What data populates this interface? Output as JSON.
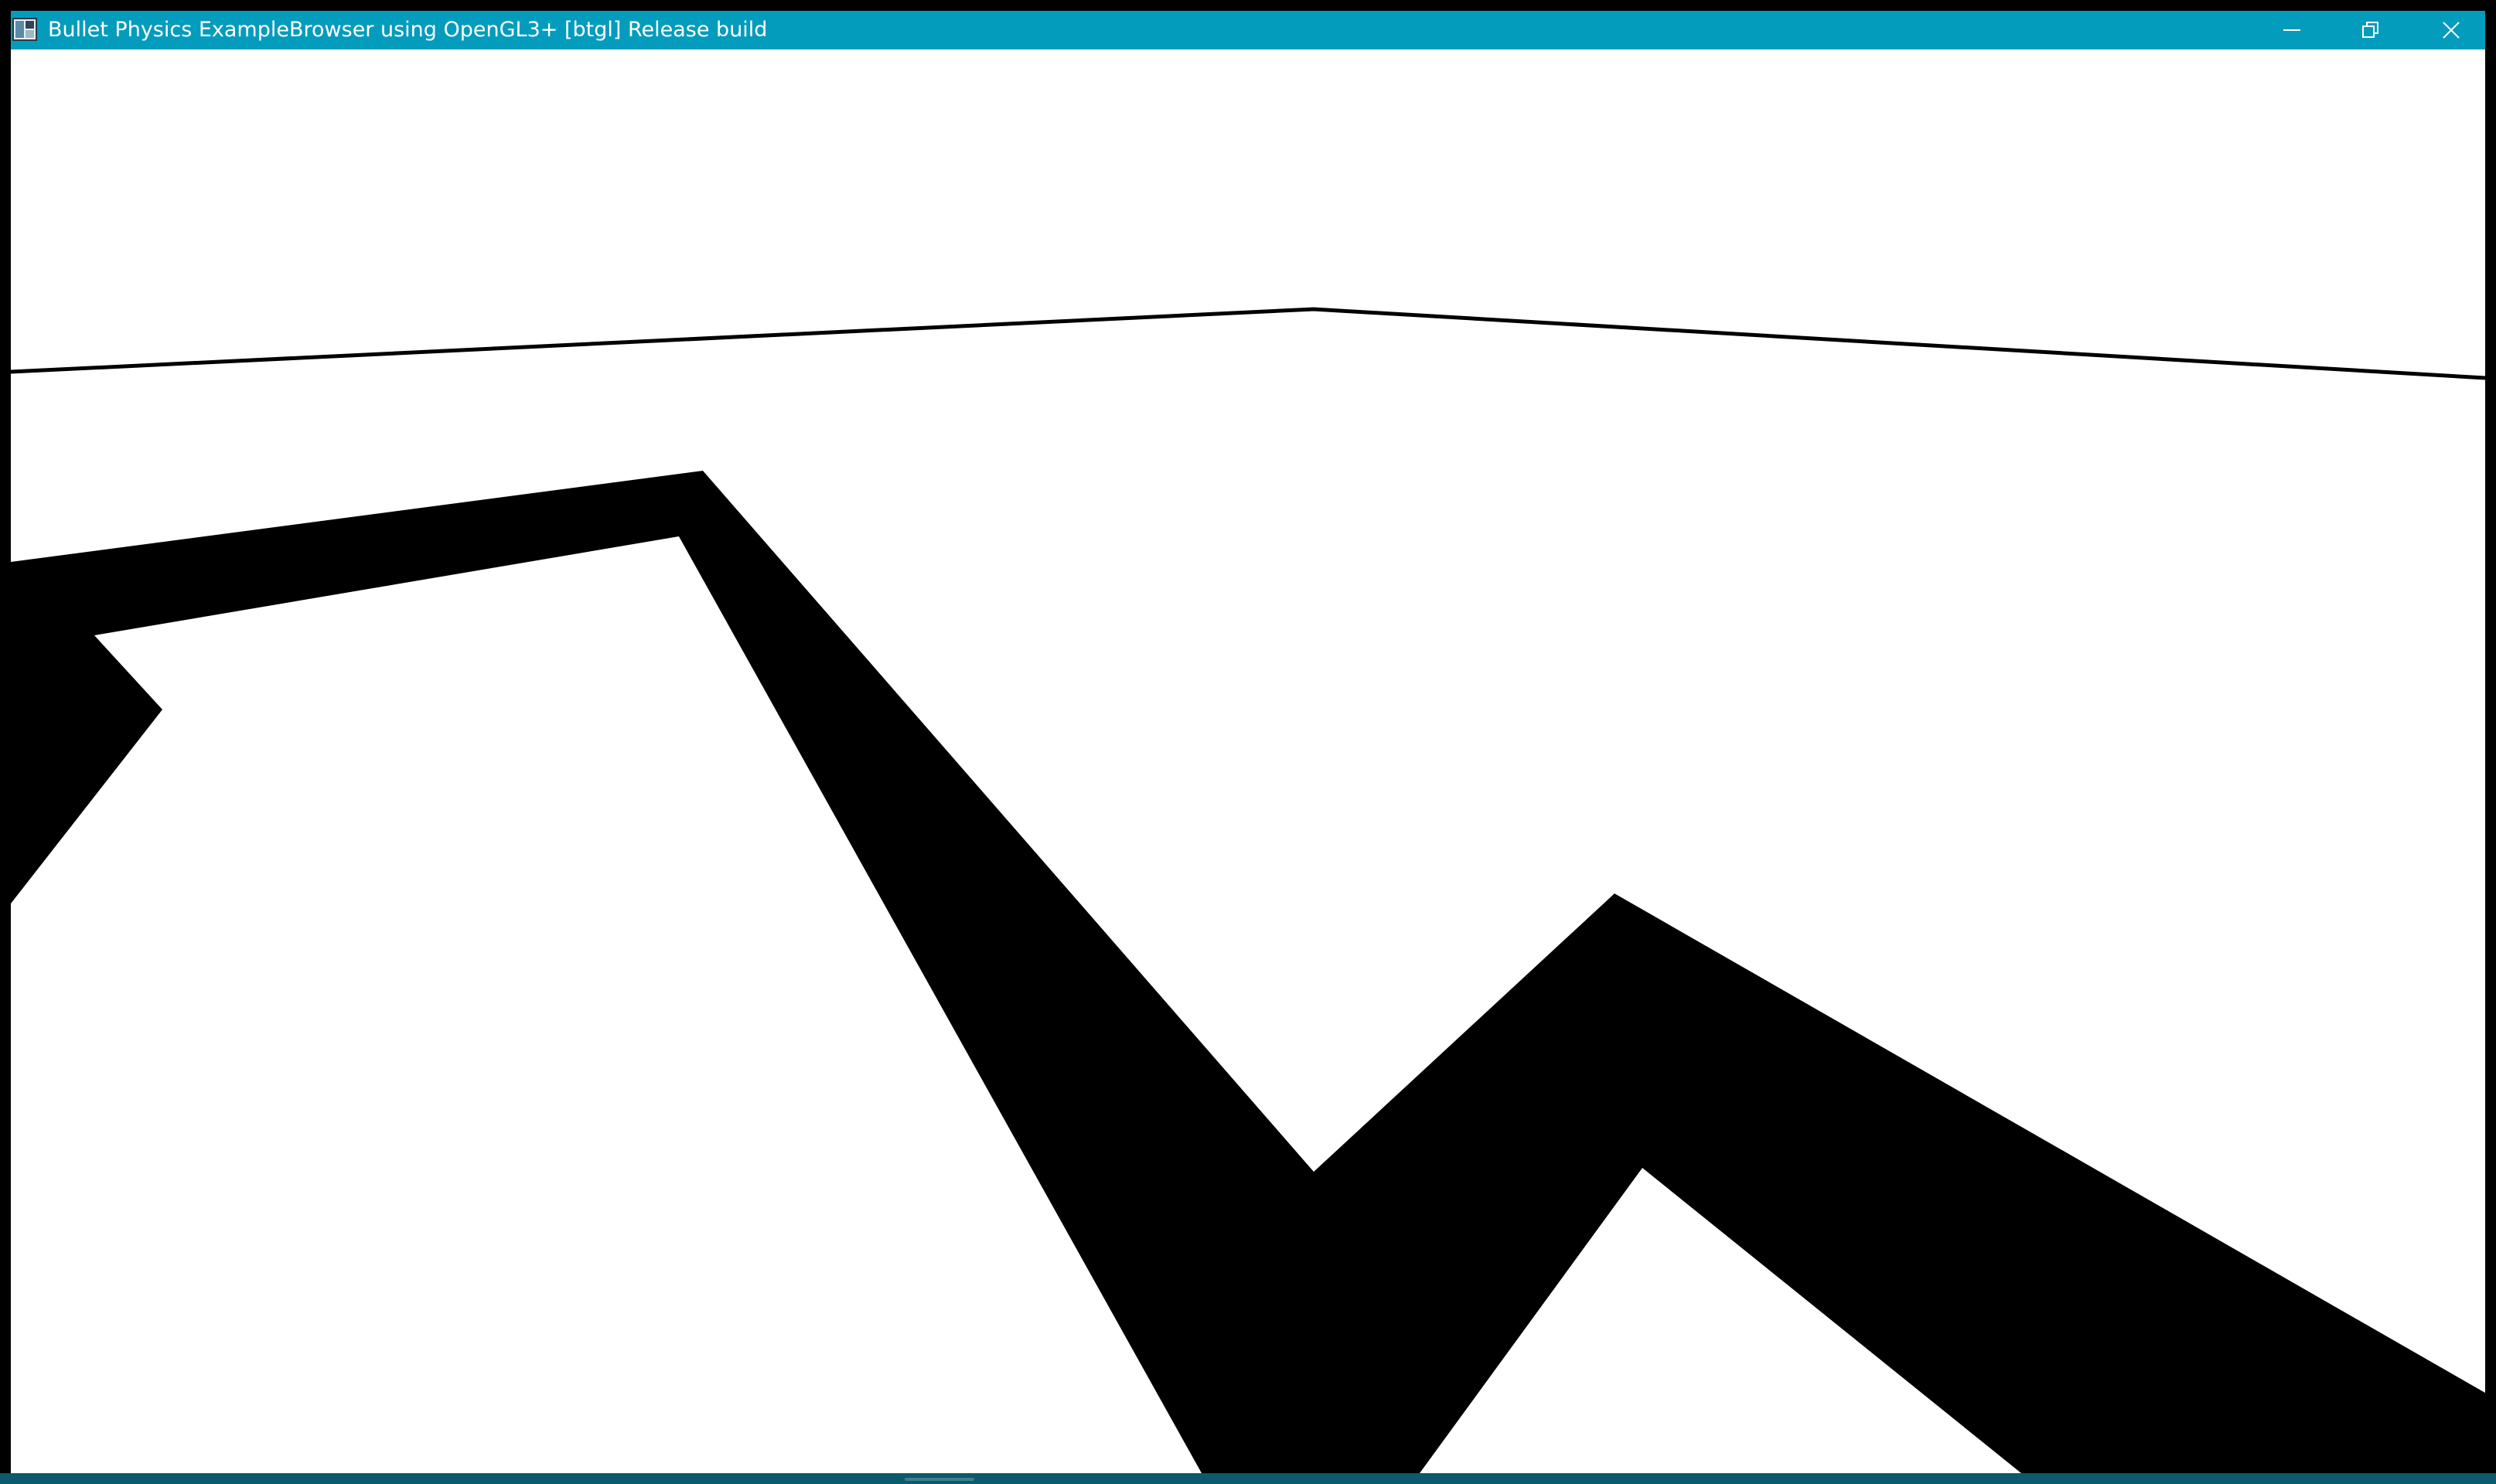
{
  "window": {
    "title": "Bullet Physics ExampleBrowser using OpenGL3+ [btgl] Release build",
    "titlebar_color": "#049cbd",
    "app_icon": "app-window-icon",
    "controls": {
      "minimize_icon": "minimize-icon",
      "maximize_icon": "restore-icon",
      "close_icon": "close-icon"
    }
  },
  "viewport": {
    "background_color": "#ffffff",
    "shape_color": "#000000",
    "content": "3d-render"
  }
}
